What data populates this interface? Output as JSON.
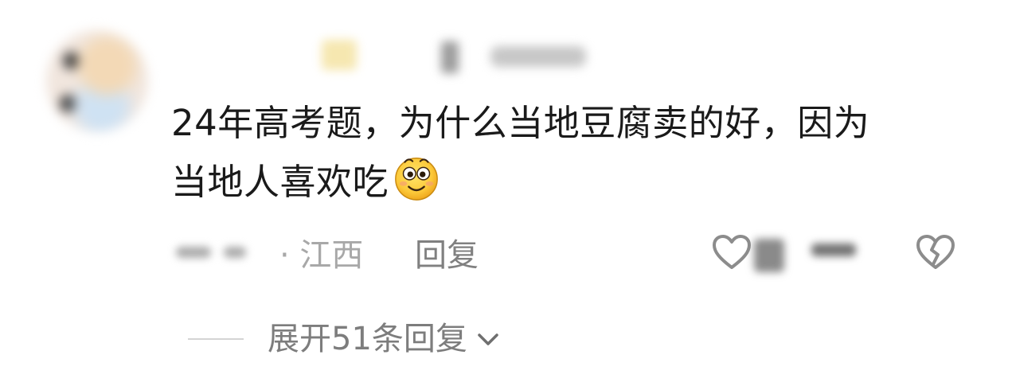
{
  "comment": {
    "text_line1": "24年高考题，为什么当地豆腐卖的好，因为",
    "text_line2": "当地人喜欢吃",
    "emoji": "smile-emoji"
  },
  "meta": {
    "location": "· 江西",
    "reply_label": "回复"
  },
  "replies": {
    "expand_label": "展开51条回复"
  },
  "icons": {
    "like": "heart-outline-icon",
    "dislike": "broken-heart-icon",
    "expand": "chevron-down-icon"
  },
  "colors": {
    "text": "#1a1a1a",
    "meta_text": "#a8a8a8",
    "reply_text": "#808080",
    "icon_stroke": "#8c8c8c"
  }
}
